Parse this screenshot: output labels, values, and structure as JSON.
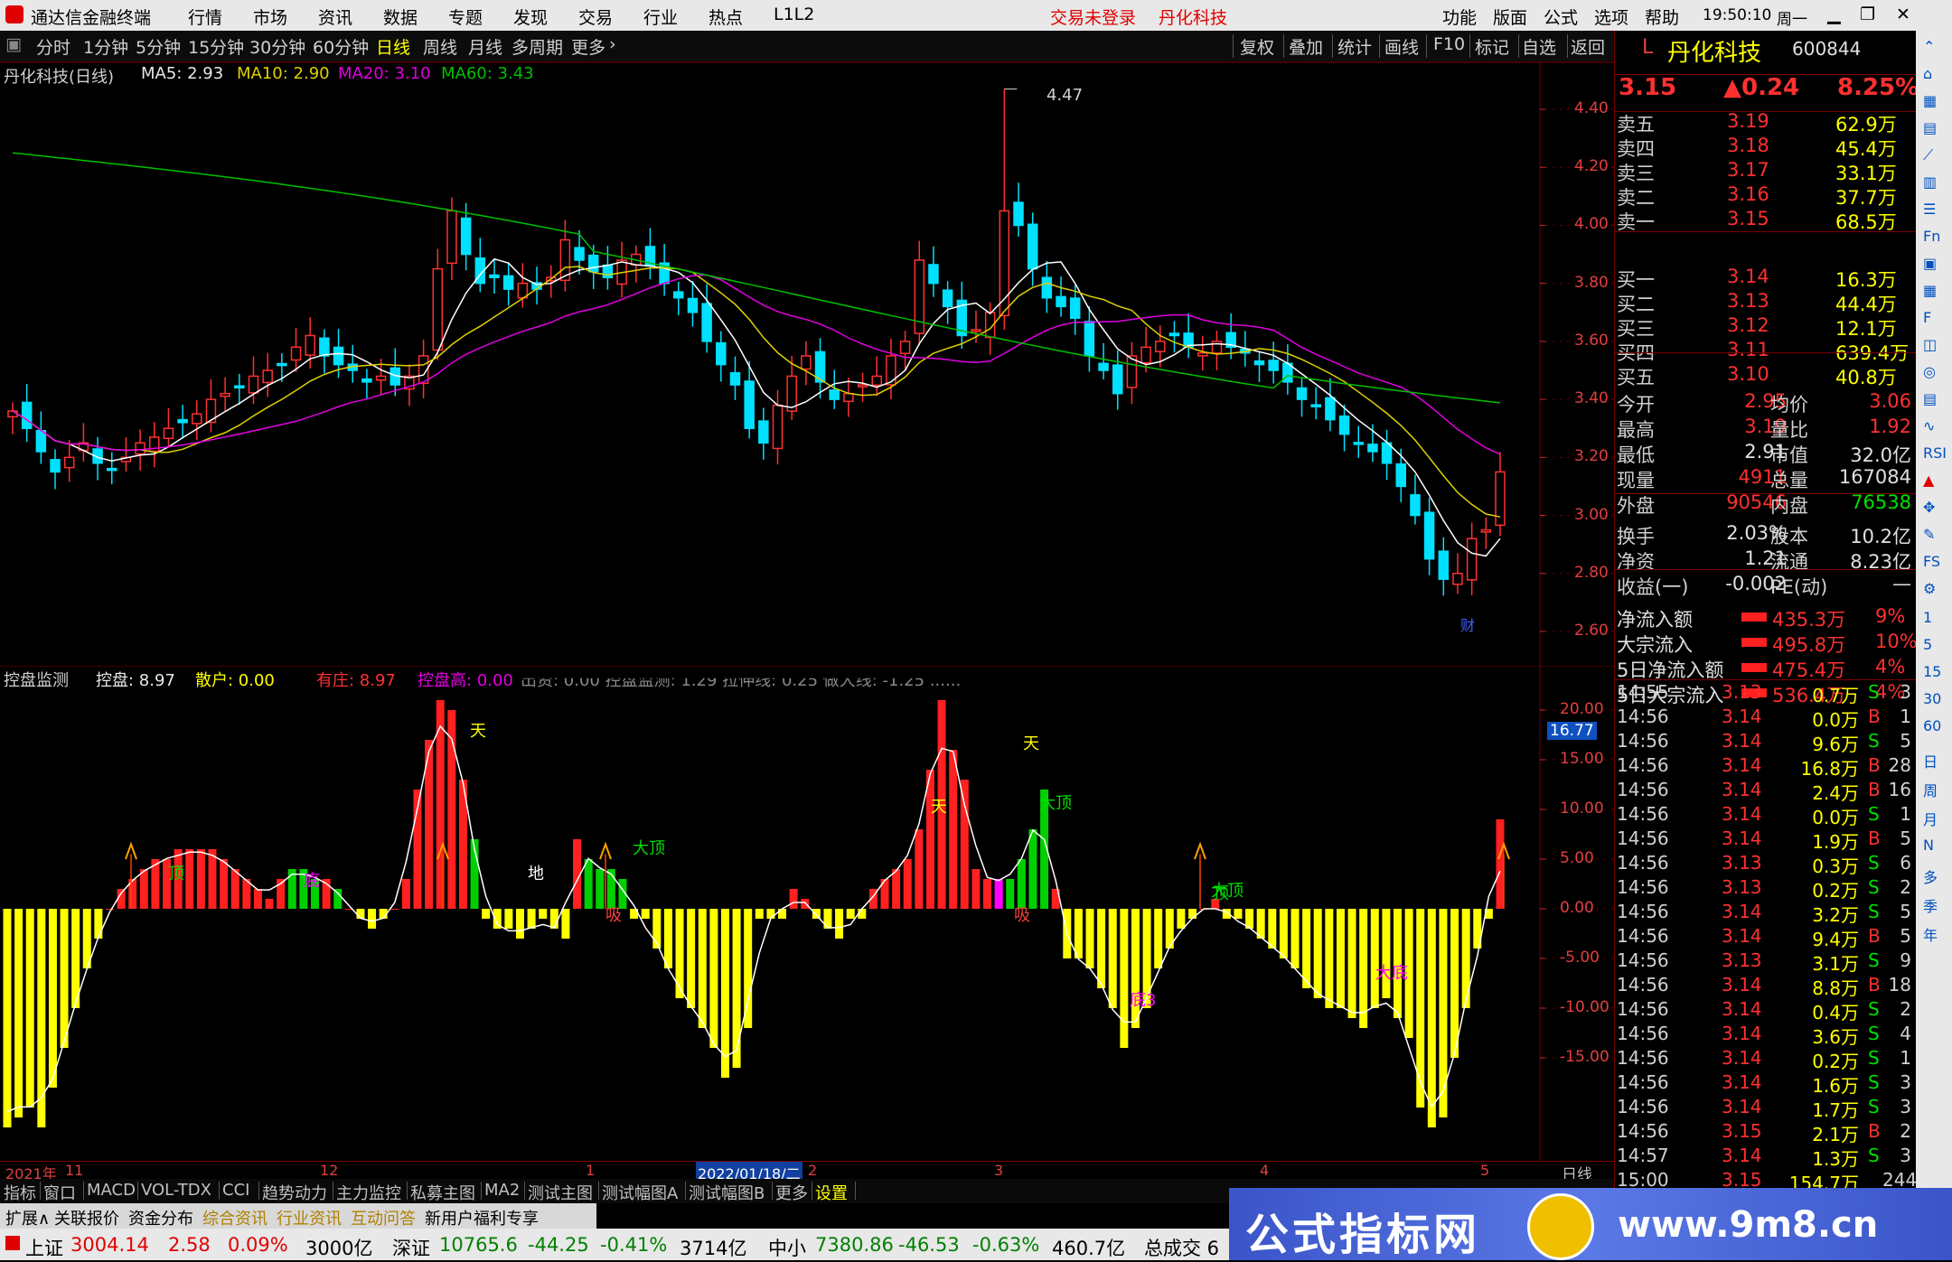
{
  "titlebar": {
    "app_name": "通达信金融终端",
    "menu": [
      "行情",
      "市场",
      "资讯",
      "数据",
      "专题",
      "发现",
      "交易",
      "行业",
      "热点",
      "L1L2"
    ],
    "center_status": "交易未登录",
    "center_stock": "丹化科技",
    "right_menu": [
      "功能",
      "版面",
      "公式",
      "选项",
      "帮助"
    ],
    "time": "19:50:10",
    "weekday": "周一"
  },
  "toolbar": {
    "periods": [
      "分时",
      "1分钟",
      "5分钟",
      "15分钟",
      "30分钟",
      "60分钟",
      "日线",
      "周线",
      "月线",
      "多周期",
      "更多"
    ],
    "selected_period": "日线",
    "actions": [
      "复权",
      "叠加",
      "统计",
      "画线",
      "F10",
      "标记",
      "自选",
      "返回"
    ]
  },
  "kline": {
    "legend": {
      "name": "丹化科技(日线)",
      "ma5": "MA5: 2.93",
      "ma10": "MA10: 2.90",
      "ma20": "MA20: 3.10",
      "ma60": "MA60: 3.43"
    },
    "peak_label": "4.47",
    "yticks": [
      "4.40",
      "4.20",
      "4.00",
      "3.80",
      "3.60",
      "3.40",
      "3.20",
      "3.00",
      "2.80",
      "2.60"
    ],
    "marker": "财",
    "colors": {
      "up": "#ff3030",
      "down": "#00e0ff",
      "ma5": "#ffffff",
      "ma10": "#e0d000",
      "ma20": "#e000e0",
      "ma60": "#00c000"
    }
  },
  "indicator": {
    "legend": {
      "name": "控盘监测",
      "kongpan": "控盘: 8.97",
      "sanhu": "散户: 0.00",
      "youzhuang": "有庄: 8.97",
      "kongpangao": "控盘高: 0.00",
      "rest": "出资: 0.00   控盘监测: 1.29   拉伸线: 0.25   做大线: -1.25   ......"
    },
    "current_value": "16.77",
    "yticks": [
      "20.00",
      "15.00",
      "10.00",
      "5.00",
      "0.00",
      "-5.00",
      "-10.00",
      "-15.00"
    ],
    "annotations": [
      "天",
      "天",
      "天",
      "顶",
      "顶",
      "大顶",
      "大顶",
      "大顶",
      "地",
      "底",
      "吸",
      "吸",
      "底3",
      "大底"
    ],
    "colors": {
      "pos": "#ff2020",
      "green": "#00d000",
      "neg": "#ffff00",
      "magenta": "#ff00ff"
    }
  },
  "xaxis": {
    "labels": [
      "2021年",
      "11",
      "12",
      "1",
      "2022/01/18/二",
      "2",
      "3",
      "4",
      "5"
    ],
    "period": "日线"
  },
  "quote": {
    "code_prefix": "L",
    "name": "丹化科技",
    "code": "600844",
    "price": "3.15",
    "change": "▲0.24",
    "pct": "8.25%",
    "asks": [
      {
        "label": "卖五",
        "price": "3.19",
        "vol": "62.9万"
      },
      {
        "label": "卖四",
        "price": "3.18",
        "vol": "45.4万"
      },
      {
        "label": "卖三",
        "price": "3.17",
        "vol": "33.1万"
      },
      {
        "label": "卖二",
        "price": "3.16",
        "vol": "37.7万"
      },
      {
        "label": "卖一",
        "price": "3.15",
        "vol": "68.5万"
      }
    ],
    "bids": [
      {
        "label": "买一",
        "price": "3.14",
        "vol": "16.3万"
      },
      {
        "label": "买二",
        "price": "3.13",
        "vol": "44.4万"
      },
      {
        "label": "买三",
        "price": "3.12",
        "vol": "12.1万"
      },
      {
        "label": "买四",
        "price": "3.11",
        "vol": "639.4万"
      },
      {
        "label": "买五",
        "price": "3.10",
        "vol": "40.8万"
      }
    ],
    "stats": [
      [
        "今开",
        "2.95",
        "均价",
        "3.06"
      ],
      [
        "最高",
        "3.19",
        "量比",
        "1.92"
      ],
      [
        "最低",
        "2.91",
        "市值",
        "32.0亿"
      ],
      [
        "现量",
        "4911",
        "总量",
        "167084"
      ],
      [
        "外盘",
        "90546",
        "内盘",
        "76538"
      ],
      [
        "换手",
        "2.03%",
        "股本",
        "10.2亿"
      ],
      [
        "净资",
        "1.21",
        "流通",
        "8.23亿"
      ],
      [
        "收益(一)",
        "-0.002",
        "PE(动)",
        "—"
      ]
    ],
    "flows": [
      {
        "label": "净流入额",
        "value": "435.3万",
        "pct": "9%"
      },
      {
        "label": "大宗流入",
        "value": "495.8万",
        "pct": "10%"
      },
      {
        "label": "5日净流入额",
        "value": "475.4万",
        "pct": "4%"
      },
      {
        "label": "5日大宗流入",
        "value": "536.4万",
        "pct": "4%"
      }
    ],
    "ticks": [
      [
        "14:55",
        "3.13",
        "0.7万",
        "S",
        "3"
      ],
      [
        "14:56",
        "3.14",
        "0.0万",
        "B",
        "1"
      ],
      [
        "14:56",
        "3.14",
        "9.6万",
        "S",
        "5"
      ],
      [
        "14:56",
        "3.14",
        "16.8万",
        "B",
        "28"
      ],
      [
        "14:56",
        "3.14",
        "2.4万",
        "B",
        "16"
      ],
      [
        "14:56",
        "3.14",
        "0.0万",
        "S",
        "1"
      ],
      [
        "14:56",
        "3.14",
        "1.9万",
        "B",
        "5"
      ],
      [
        "14:56",
        "3.13",
        "0.3万",
        "S",
        "6"
      ],
      [
        "14:56",
        "3.13",
        "0.2万",
        "S",
        "2"
      ],
      [
        "14:56",
        "3.14",
        "3.2万",
        "S",
        "5"
      ],
      [
        "14:56",
        "3.14",
        "9.4万",
        "B",
        "5"
      ],
      [
        "14:56",
        "3.13",
        "3.1万",
        "S",
        "9"
      ],
      [
        "14:56",
        "3.14",
        "8.8万",
        "B",
        "18"
      ],
      [
        "14:56",
        "3.14",
        "0.4万",
        "S",
        "2"
      ],
      [
        "14:56",
        "3.14",
        "3.6万",
        "S",
        "4"
      ],
      [
        "14:56",
        "3.14",
        "0.2万",
        "S",
        "1"
      ],
      [
        "14:56",
        "3.14",
        "1.6万",
        "S",
        "3"
      ],
      [
        "14:56",
        "3.14",
        "1.7万",
        "S",
        "3"
      ],
      [
        "14:56",
        "3.15",
        "2.1万",
        "B",
        "2"
      ],
      [
        "14:57",
        "3.14",
        "1.3万",
        "S",
        "3"
      ],
      [
        "15:00",
        "3.15",
        "154.7万",
        "",
        "244"
      ]
    ]
  },
  "sidestrip": [
    "日",
    "周",
    "月",
    "N",
    "多",
    "季",
    "年"
  ],
  "tabs": [
    "指标",
    "窗口",
    "MACD",
    "VOL-TDX",
    "CCI",
    "趋势动力",
    "主力监控",
    "私募主图",
    "MA2",
    "测试主图",
    "测试幅图A",
    "测试幅图B",
    "更多",
    "设置"
  ],
  "tabs2": [
    "扩展∧",
    "关联报价",
    "资金分布",
    "综合资讯",
    "行业资讯",
    "互动问答",
    "新用户福利专享"
  ],
  "status": {
    "sh_label": "上证",
    "sh_val": "3004.14",
    "sh_chg": "2.58",
    "sh_pct": "0.09%",
    "sh_amt": "3000亿",
    "sz_label": "深证",
    "sz_val": "10765.6",
    "sz_chg": "-44.25",
    "sz_pct": "-0.41%",
    "sz_amt": "3714亿",
    "zx_label": "中小",
    "zx_val": "7380.86",
    "zx_chg": "-46.53",
    "zx_pct": "-0.63%",
    "zx_amt": "460.7亿",
    "zcj": "总成交 6"
  },
  "banner": {
    "text": "公式指标网",
    "url": "www.9m8.cn"
  }
}
